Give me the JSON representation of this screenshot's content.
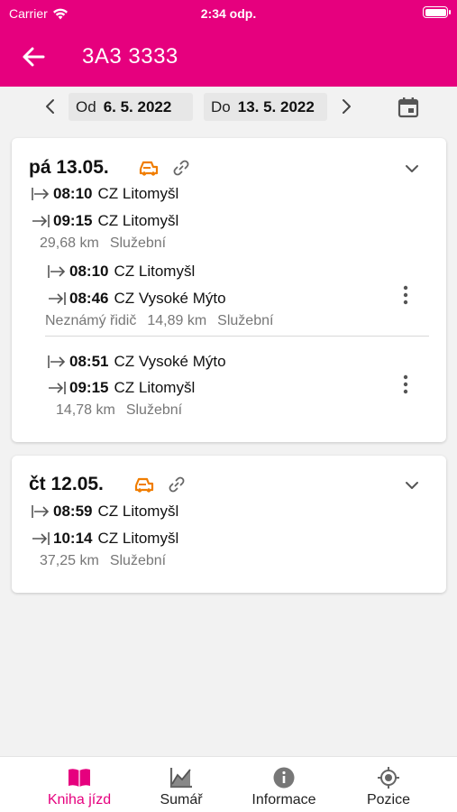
{
  "status": {
    "carrier": "Carrier",
    "time": "2:34 odp."
  },
  "header": {
    "title": "3A3 3333"
  },
  "filter": {
    "from_label": "Od",
    "from_date": "6. 5. 2022",
    "to_label": "Do",
    "to_date": "13. 5. 2022"
  },
  "colors": {
    "brand": "#e6007e",
    "vehicle_icon": "#f07d00"
  },
  "days": [
    {
      "date": "pá 13.05.",
      "summary": {
        "start_time": "08:10",
        "start_place": "CZ Litomyšl",
        "end_time": "09:15",
        "end_place": "CZ Litomyšl",
        "distance": "29,68 km",
        "type": "Služební"
      },
      "trips": [
        {
          "start_time": "08:10",
          "start_place": "CZ Litomyšl",
          "end_time": "08:46",
          "end_place": "CZ Vysoké Mýto",
          "driver": "Neznámý řidič",
          "distance": "14,89 km",
          "type": "Služební"
        },
        {
          "start_time": "08:51",
          "start_place": "CZ Vysoké Mýto",
          "end_time": "09:15",
          "end_place": "CZ Litomyšl",
          "distance": "14,78 km",
          "type": "Služební"
        }
      ]
    },
    {
      "date": "čt 12.05.",
      "summary": {
        "start_time": "08:59",
        "start_place": "CZ Litomyšl",
        "end_time": "10:14",
        "end_place": "CZ Litomyšl",
        "distance": "37,25 km",
        "type": "Služební"
      }
    }
  ],
  "nav": [
    {
      "label": "Kniha jízd",
      "icon": "book-icon",
      "active": true
    },
    {
      "label": "Sumář",
      "icon": "chart-icon",
      "active": false
    },
    {
      "label": "Informace",
      "icon": "info-icon",
      "active": false
    },
    {
      "label": "Pozice",
      "icon": "location-icon",
      "active": false
    }
  ]
}
